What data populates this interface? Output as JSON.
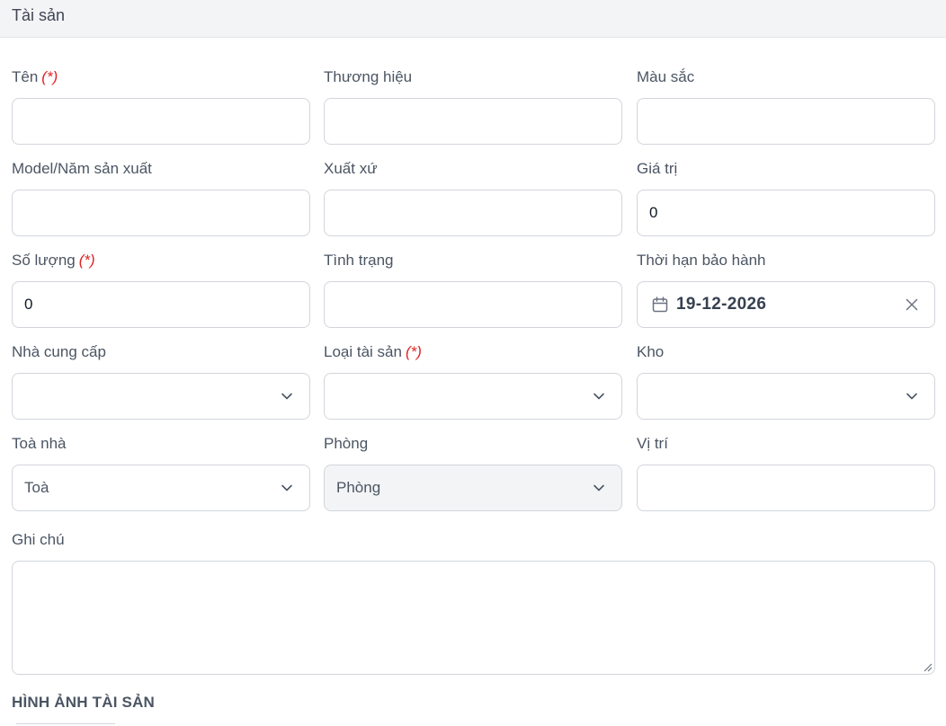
{
  "header": {
    "title": "Tài sản"
  },
  "form": {
    "required_mark": "(*)",
    "name": {
      "label": "Tên",
      "value": ""
    },
    "brand": {
      "label": "Thương hiệu",
      "value": ""
    },
    "color": {
      "label": "Màu sắc",
      "value": ""
    },
    "model_year": {
      "label": "Model/Năm sản xuất",
      "value": ""
    },
    "origin": {
      "label": "Xuất xứ",
      "value": ""
    },
    "value": {
      "label": "Giá trị",
      "value": "0"
    },
    "quantity": {
      "label": "Số lượng",
      "value": "0"
    },
    "condition": {
      "label": "Tình trạng",
      "value": ""
    },
    "warranty": {
      "label": "Thời hạn bảo hành",
      "value": "19-12-2026"
    },
    "supplier": {
      "label": "Nhà cung cấp",
      "value": ""
    },
    "asset_type": {
      "label": "Loại tài sản",
      "value": ""
    },
    "warehouse": {
      "label": "Kho",
      "value": ""
    },
    "building": {
      "label": "Toà nhà",
      "value": "Toà"
    },
    "room": {
      "label": "Phòng",
      "value": "Phòng"
    },
    "location": {
      "label": "Vị trí",
      "value": ""
    },
    "note": {
      "label": "Ghi chú",
      "value": ""
    }
  },
  "images_section": {
    "title": "HÌNH ẢNH TÀI SẢN"
  },
  "icons": {
    "calendar": "calendar-icon",
    "clear": "close-icon",
    "chevron": "chevron-down-icon"
  },
  "colors": {
    "required": "#e02424",
    "border": "#d1d5db",
    "disabled_bg": "#f3f4f6",
    "header_bg": "#f3f4f6"
  }
}
